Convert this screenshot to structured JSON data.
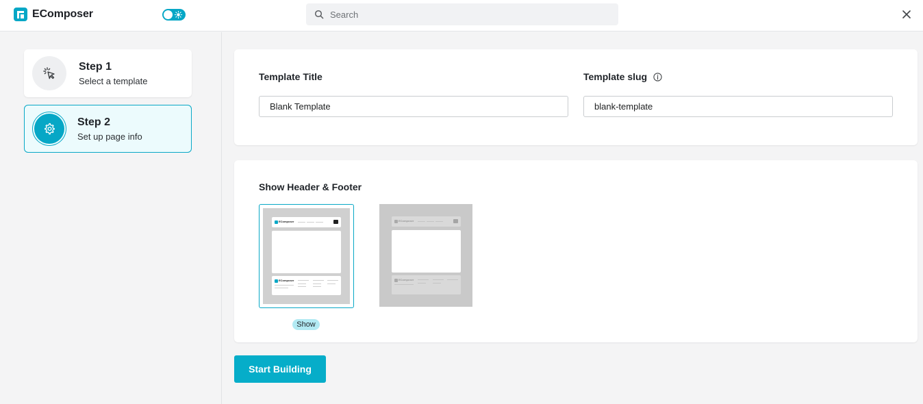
{
  "app": {
    "name": "EComposer"
  },
  "search": {
    "placeholder": "Search"
  },
  "steps": [
    {
      "title": "Step 1",
      "subtitle": "Select a template"
    },
    {
      "title": "Step 2",
      "subtitle": "Set up page info"
    }
  ],
  "form": {
    "title_label": "Template Title",
    "title_value": "Blank Template",
    "slug_label": "Template slug",
    "slug_value": "blank-template"
  },
  "header_footer": {
    "section_title": "Show Header & Footer",
    "show_badge": "Show",
    "preview_brand": "EComposer"
  },
  "actions": {
    "start_label": "Start Building"
  },
  "colors": {
    "accent": "#06adc9",
    "accent_light": "#ecfbfd"
  }
}
